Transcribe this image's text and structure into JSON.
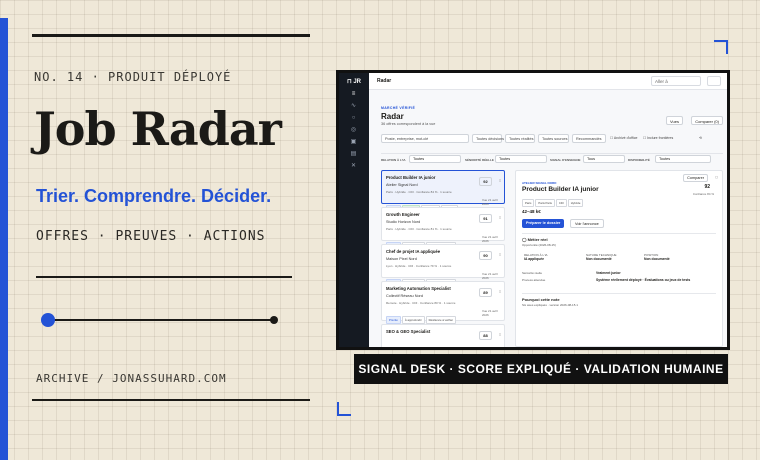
{
  "cover": {
    "issue": "NO. 14 · PRODUIT DÉPLOYÉ",
    "title": "Job Radar",
    "tagline": "Trier. Comprendre. Décider.",
    "keywords": "OFFRES · PREUVES · ACTIONS",
    "archive": "ARCHIVE / JONASSUHARD.COM",
    "banner": "SIGNAL DESK · SCORE EXPLIQUÉ · VALIDATION HUMAINE",
    "accent_color": "#2453d6"
  },
  "app": {
    "topbar_title": "Radar",
    "search_placeholder": "Aller à",
    "kicker": "MARCHÉ VÉRIFIÉ",
    "heading": "Radar",
    "subheading": "36 offres correspondent à la vue",
    "view_button": "Vues",
    "compare_button": "Comparer (0)",
    "filters": {
      "search_placeholder": "Poste, entreprise, mot-clé",
      "decision": "Toutes décisions",
      "levels": "Toutes réalités",
      "sources": "Toutes sources",
      "recommendation": "Recommandés",
      "archived": "Archivés",
      "proof": "Archivé d'office",
      "include": "Inclure frontières"
    },
    "row2": {
      "relation_label": "RELATION À L'IA",
      "relation_value": "Toutes",
      "seniority_label": "SÉNIORITÉ RÉELLE",
      "seniority_value": "Toutes",
      "signal_label": "SIGNAL D'ENSEIGNE",
      "signal_value": "Tous",
      "availability_label": "DISPONIBILITÉ",
      "availability_value": "Toutes"
    },
    "jobs": [
      {
        "title": "Product Builder IA junior",
        "company": "Atelier Signal Nord",
        "meta": "Paris · Hybride · CDI · Confiance 84 % · 1 source",
        "score": "92",
        "chips": [
          "Priorité",
          "Conforme",
          "Résilience",
          "Nouveau"
        ],
        "date": "Vue 21 avril 2026"
      },
      {
        "title": "Growth Engineer",
        "company": "Studio Horizon Nord",
        "meta": "Paris · Hybride · CDI · Confiance 81 % · 1 source",
        "score": "91",
        "chips": [
          "Priorité",
          "À approfondir",
          "Résilience à vérifier",
          "Nouveau"
        ],
        "date": "Vue 21 avril 2026"
      },
      {
        "title": "Chef de projet IA appliquée",
        "company": "Maison Pixel Nord",
        "meta": "Lyon · Hybride · CDI · Confiance 79 % · 1 source",
        "score": "90",
        "chips": [
          "Priorité",
          "À approfondir",
          "Résilience à vérifier",
          "Nouveau"
        ],
        "date": "Vue 21 avril 2026"
      },
      {
        "title": "Marketing Automation Specialist",
        "company": "Collectif Réseau Nord",
        "meta": "Remote · Hybride · CDI · Confiance 80 % · 1 source",
        "score": "89",
        "chips": [
          "Priorité",
          "À approfondir",
          "Résilience à vérifier",
          "Nouveau"
        ],
        "date": "Vue 21 avril 2026"
      },
      {
        "title": "SEO & GEO Specialist",
        "company": "",
        "meta": "",
        "score": "88",
        "chips": [],
        "date": ""
      }
    ],
    "detail": {
      "kicker": "ATELIER SIGNAL NORD",
      "title": "Product Builder IA junior",
      "tags": [
        "Paris",
        "Paris Paris",
        "CDI",
        "Hybride"
      ],
      "score": "92",
      "score_label": "Confiance 84 %",
      "salary": "42–48 k€",
      "compare": "Comparer",
      "primary_button": "Préparer le dossier",
      "secondary_button": "Voir l'annonce",
      "section_metier": "Métier réel",
      "metier_sub": "Opportunité (2026-08-15)",
      "relation_label": "RELATION À L'IA",
      "relation_value": "IA appliquée",
      "nature_label": "NATURE TECHNIQUE",
      "nature_value": "Non documenté",
      "position_label": "POSITION",
      "position_value": "Non documenté",
      "seniority_label": "Séniorité réelle",
      "seniority_value": "Vraiment junior",
      "process_label": "Process attendue",
      "process_value": "Système réellement déployé · Évaluations ou jeux de tests",
      "section_why": "Pourquoi cette note",
      "why_sub": "Six axes expliqués · version 2026-08-15.1"
    }
  }
}
